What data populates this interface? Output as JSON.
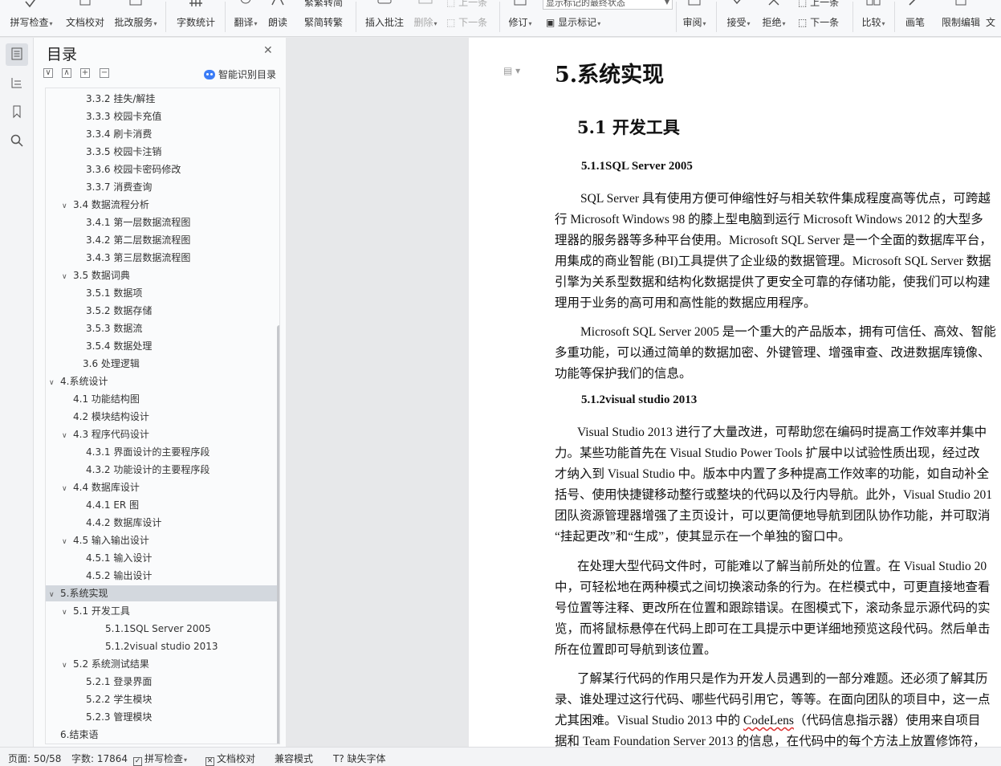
{
  "ribbon": {
    "spell_check": "拼写检查",
    "doc_proof": "文档校对",
    "batch_service": "批改服务",
    "word_count": "字数统计",
    "translate": "翻译",
    "read_aloud": "朗读",
    "trad_convert": "繁转简",
    "simp_convert": "简转繁",
    "insert_comment": "插入批注",
    "delete": "删除",
    "prev": "上一条",
    "next": "下一条",
    "revise": "修订",
    "markup_select": "显示标记的最终状态",
    "show_markup": "显示标记",
    "review": "审阅",
    "accept": "接受",
    "reject": "拒绝",
    "prev2": "上一条",
    "next2": "下一条",
    "compare": "比较",
    "pen": "画笔",
    "restrict_edit": "限制编辑",
    "doc_more": "文"
  },
  "toc": {
    "title": "目录",
    "smart": "智能识别目录",
    "items": [
      {
        "text": "3.3.2 挂失/解挂",
        "level": 3,
        "toggle": ""
      },
      {
        "text": "3.3.3 校园卡充值",
        "level": 3,
        "toggle": ""
      },
      {
        "text": "3.3.4 刷卡消费",
        "level": 3,
        "toggle": ""
      },
      {
        "text": "3.3.5 校园卡注销",
        "level": 3,
        "toggle": ""
      },
      {
        "text": "3.3.6 校园卡密码修改",
        "level": 3,
        "toggle": ""
      },
      {
        "text": "3.3.7 消费查询",
        "level": 3,
        "toggle": ""
      },
      {
        "text": "3.4 数据流程分析",
        "level": 2,
        "toggle": "∨"
      },
      {
        "text": "3.4.1 第一层数据流程图",
        "level": 3,
        "toggle": ""
      },
      {
        "text": "3.4.2 第二层数据流程图",
        "level": 3,
        "toggle": ""
      },
      {
        "text": "3.4.3 第三层数据流程图",
        "level": 3,
        "toggle": ""
      },
      {
        "text": "3.5 数据词典",
        "level": 2,
        "toggle": "∨"
      },
      {
        "text": "3.5.1 数据项",
        "level": 3,
        "toggle": ""
      },
      {
        "text": "3.5.2 数据存储",
        "level": 3,
        "toggle": ""
      },
      {
        "text": "3.5.3  数据流",
        "level": 3,
        "toggle": ""
      },
      {
        "text": "3.5.4 数据处理",
        "level": 3,
        "toggle": ""
      },
      {
        "text": "3.6 处理逻辑",
        "level": 2.8,
        "toggle": ""
      },
      {
        "text": "4.系统设计",
        "level": 1,
        "toggle": "∨"
      },
      {
        "text": "4.1 功能结构图",
        "level": 2,
        "toggle": ""
      },
      {
        "text": "4.2 模块结构设计",
        "level": 2,
        "toggle": ""
      },
      {
        "text": "4.3 程序代码设计",
        "level": 2,
        "toggle": "∨"
      },
      {
        "text": "4.3.1 界面设计的主要程序段",
        "level": 3,
        "toggle": ""
      },
      {
        "text": "4.3.2 功能设计的主要程序段",
        "level": 3,
        "toggle": ""
      },
      {
        "text": "4.4 数据库设计",
        "level": 2,
        "toggle": "∨"
      },
      {
        "text": "4.4.1 ER 图",
        "level": 3,
        "toggle": ""
      },
      {
        "text": "4.4.2 数据库设计",
        "level": 3,
        "toggle": ""
      },
      {
        "text": "4.5 输入输出设计",
        "level": 2,
        "toggle": "∨"
      },
      {
        "text": "4.5.1 输入设计",
        "level": 3,
        "toggle": ""
      },
      {
        "text": "4.5.2 输出设计",
        "level": 3,
        "toggle": ""
      },
      {
        "text": "5.系统实现",
        "level": 1,
        "toggle": "∨",
        "selected": true
      },
      {
        "text": "5.1 开发工具",
        "level": 2,
        "toggle": "∨"
      },
      {
        "text": "5.1.1SQL Server 2005",
        "level": 4,
        "toggle": ""
      },
      {
        "text": "5.1.2visual studio 2013",
        "level": 4,
        "toggle": ""
      },
      {
        "text": "5.2 系统测试结果",
        "level": 2,
        "toggle": "∨"
      },
      {
        "text": "5.2.1 登录界面",
        "level": 3,
        "toggle": ""
      },
      {
        "text": "5.2.2 学生模块",
        "level": 3,
        "toggle": ""
      },
      {
        "text": "5.2.3 管理模块",
        "level": 3,
        "toggle": ""
      },
      {
        "text": "6.结束语",
        "level": 1,
        "toggle": ""
      }
    ]
  },
  "doc": {
    "h1": "5.系统实现",
    "h2": "5.1 开发工具",
    "h3a": "5.1.1SQL Server 2005",
    "h3b": "5.1.2visual studio 2013",
    "lines_a": [
      "SQL Server 具有使用方便可伸缩性好与相关软件集成程度高等优点，可跨越",
      "行 Microsoft Windows 98  的膝上型电脑到运行 Microsoft Windows 2012  的大型多",
      "理器的服务器等多种平台使用。Microsoft SQL Server  是一个全面的数据库平台，",
      "用集成的商业智能 (BI)工具提供了企业级的数据管理。Microsoft SQL Server 数据",
      "引擎为关系型数据和结构化数据提供了更安全可靠的存储功能，使我们可以构建",
      "理用于业务的高可用和高性能的数据应用程序。"
    ],
    "lines_b": [
      "Microsoft SQL Server 2005 是一个重大的产品版本，拥有可信任、高效、智能",
      "多重功能，可以通过简单的数据加密、外键管理、增强审查、改进数据库镜像、",
      "功能等保护我们的信息。"
    ],
    "lines_c": [
      "Visual Studio 2013  进行了大量改进，可帮助您在编码时提高工作效率并集中",
      "力。某些功能首先在  Visual Studio Power Tools  扩展中以试验性质出现，经过改",
      "才纳入到  Visual Studio  中。版本中内置了多种提高工作效率的功能，如自动补全",
      "括号、使用快捷键移动整行或整块的代码以及行内导航。此外，Visual Studio 201",
      "团队资源管理器增强了主页设计，可以更简便地导航到团队协作功能，并可取消",
      "“挂起更改”和“生成”，使其显示在一个单独的窗口中。"
    ],
    "lines_d": [
      "在处理大型代码文件时，可能难以了解当前所处的位置。在  Visual Studio 20",
      "中，可轻松地在两种模式之间切换滚动条的行为。在栏模式中，可更直接地查看",
      "号位置等注释、更改所在位置和跟踪错误。在图模式下，滚动条显示源代码的实",
      "览，而将鼠标悬停在代码上即可在工具提示中更详细地预览这段代码。然后单击",
      "所在位置即可导航到该位置。"
    ],
    "lines_e": [
      "了解某行代码的作用只是作为开发人员遇到的一部分难题。还必须了解其历",
      "录、谁处理过这行代码、哪些代码引用它，等等。在面向团队的项目中，这一点",
      "尤其困难。Visual Studio 2013  中的  CodeLens（代码信息指示器）使用来自项目",
      "据和  Team Foundation Server 2013  的信息，在代码中的每个方法上放置修饰符，"
    ]
  },
  "status": {
    "page": "页面: 50/58",
    "words": "字数: 17864",
    "spell": "拼写检查",
    "proof": "文档校对",
    "compat": "兼容模式",
    "missing_font": "缺失字体"
  }
}
